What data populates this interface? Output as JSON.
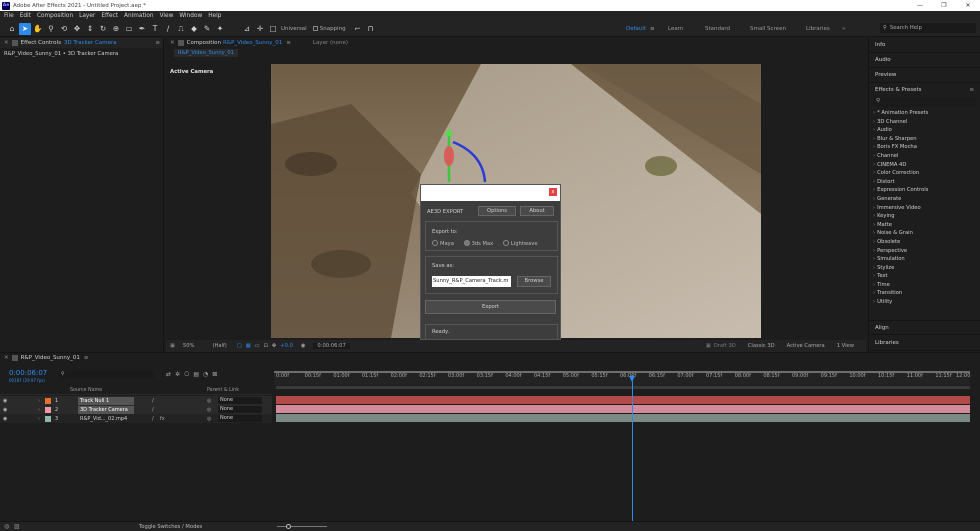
{
  "window": {
    "title": "Adobe After Effects 2021 - Untitled Project.aep *",
    "app_badge": "Ae",
    "min": "—",
    "max": "❐",
    "close": "✕"
  },
  "menu": [
    "File",
    "Edit",
    "Composition",
    "Layer",
    "Effect",
    "Animation",
    "View",
    "Window",
    "Help"
  ],
  "toolbar": {
    "universal_label": "Universal",
    "snapping_label": "Snapping",
    "workspaces": [
      "Default",
      "Learn",
      "Standard",
      "Small Screen",
      "Libraries"
    ],
    "workspace_active": "Default",
    "search_placeholder": "Search Help"
  },
  "left_panel": {
    "tab_label": "Effect Controls",
    "tab_target": "3D Tracker Camera",
    "subtitle": "R&P_Video_Sunny_01 • 3D Tracker Camera"
  },
  "comp_panel": {
    "tab_prefix": "Composition",
    "tab_name": "R&P_Video_Sunny_01",
    "layer_tab": "Layer (none)",
    "subtab": "R&P_Video_Sunny_01",
    "active_camera": "Active Camera",
    "footer": {
      "zoom": "50%",
      "resolution": "(Half)",
      "exposure": "+0.0",
      "timecode": "0:00:06:07",
      "renderer": "Draft 3D",
      "renderer2": "Classic 3D",
      "view": "Active Camera",
      "views": "1 View"
    }
  },
  "dialog": {
    "heading": "AE3D EXPORT",
    "options_btn": "Options",
    "about_btn": "About",
    "export_to_label": "Export to:",
    "targets": [
      "Maya",
      "3ds Max",
      "Lightwave"
    ],
    "save_as_label": "Save as:",
    "filename": "Sunny_R&P_Camera_Track.m",
    "browse_btn": "Browse",
    "export_btn": "Export",
    "status": "Ready.",
    "close": "x"
  },
  "right_panel": {
    "sections": [
      "Info",
      "Audio",
      "Preview"
    ],
    "effects_title": "Effects & Presets",
    "effects": [
      "* Animation Presets",
      "3D Channel",
      "Audio",
      "Blur & Sharpen",
      "Boris FX Mocha",
      "Channel",
      "CINEMA 4D",
      "Color Correction",
      "Distort",
      "Expression Controls",
      "Generate",
      "Immersive Video",
      "Keying",
      "Matte",
      "Noise & Grain",
      "Obsolete",
      "Perspective",
      "Simulation",
      "Stylize",
      "Text",
      "Time",
      "Transition",
      "Utility"
    ],
    "bottom": [
      "Align",
      "Libraries"
    ]
  },
  "timeline": {
    "comp_tab": "R&P_Video_Sunny_01",
    "timecode": "0:00:06:07",
    "fps": "00187 (29.97 fps)",
    "col_source": "Source Name",
    "col_parent": "Parent & Link",
    "layers": [
      {
        "num": "1",
        "name": "Track Null 1",
        "parent": "None",
        "color": "#e6722d"
      },
      {
        "num": "2",
        "name": "3D Tracker Camera",
        "parent": "None",
        "color": "#e89aa6"
      },
      {
        "num": "3",
        "name": "R&P_Vid..._02.mp4",
        "parent": "None",
        "color": "#8fb8a6"
      }
    ],
    "ruler": [
      "0:00f",
      "00:15f",
      "01:00f",
      "01:15f",
      "02:00f",
      "02:15f",
      "03:00f",
      "03:15f",
      "04:00f",
      "04:15f",
      "05:00f",
      "05:15f",
      "06:00f",
      "06:15f",
      "07:00f",
      "07:15f",
      "08:00f",
      "08:15f",
      "09:00f",
      "09:15f",
      "10:00f",
      "10:15f",
      "11:00f",
      "11:15f",
      "12:00"
    ],
    "current_time_fraction": 0.5174,
    "toggle_label": "Toggle Switches / Modes"
  }
}
